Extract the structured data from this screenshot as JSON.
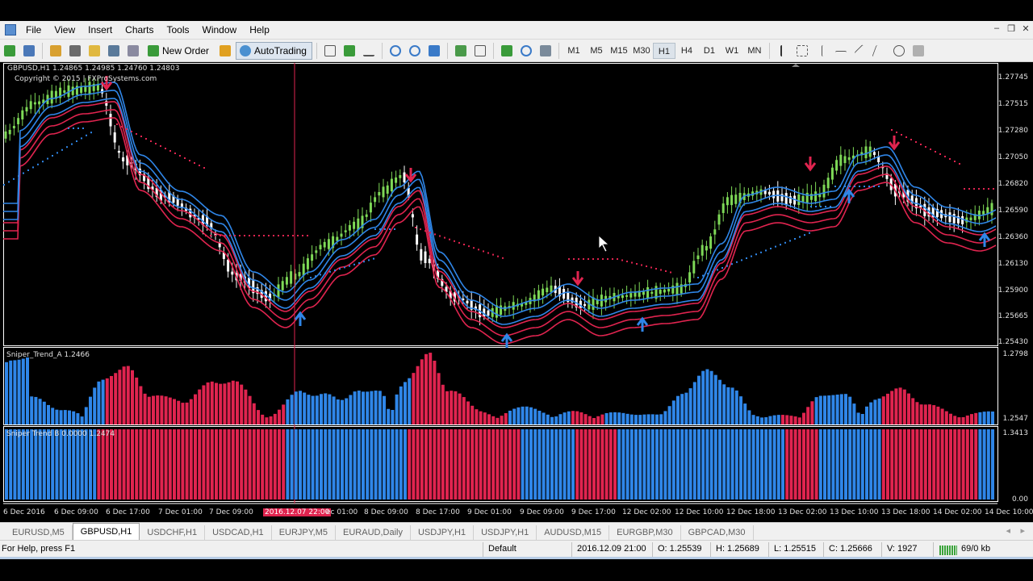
{
  "menu": [
    "File",
    "View",
    "Insert",
    "Charts",
    "Tools",
    "Window",
    "Help"
  ],
  "toolbar": {
    "new_order": "New Order",
    "autotrading": "AutoTrading",
    "timeframes": [
      "M1",
      "M5",
      "M15",
      "M30",
      "H1",
      "H4",
      "D1",
      "W1",
      "MN"
    ],
    "active_timeframe": "H1"
  },
  "chart": {
    "header": "GBPUSD,H1  1.24865 1.24985 1.24760 1.24803",
    "copyright": "Copyright © 2015 | FXProSystems.com",
    "price_labels": [
      "1.27745",
      "1.27515",
      "1.27280",
      "1.27050",
      "1.26820",
      "1.26590",
      "1.26360",
      "1.26130",
      "1.25900",
      "1.25665",
      "1.25430"
    ],
    "time_labels": [
      "6 Dec 2016",
      "6 Dec 09:00",
      "6 Dec 17:00",
      "7 Dec 01:00",
      "7 Dec 09:00",
      "2016.12.07 22:00",
      "ec 01:00",
      "8 Dec 09:00",
      "8 Dec 17:00",
      "9 Dec 01:00",
      "9 Dec 09:00",
      "9 Dec 17:00",
      "12 Dec 02:00",
      "12 Dec 10:00",
      "12 Dec 18:00",
      "13 Dec 02:00",
      "13 Dec 10:00",
      "13 Dec 18:00",
      "14 Dec 02:00",
      "14 Dec 10:00"
    ],
    "colors": {
      "bull": "#7ed957",
      "bear": "#ffffff",
      "red": "#e0244f",
      "blue": "#2f86e8"
    }
  },
  "indicator_a": {
    "label": "Sniper_Trend_A 1.2466",
    "max": "1.2798",
    "min": "1.2547"
  },
  "indicator_b": {
    "label": "Sniper Trend B 0.0000 1.2474",
    "max": "1.3413",
    "min": "0.00"
  },
  "tabs": [
    "EURUSD,M5",
    "GBPUSD,H1",
    "USDCHF,H1",
    "USDCAD,H1",
    "EURJPY,M5",
    "EURAUD,Daily",
    "USDJPY,H1",
    "USDJPY,H1",
    "AUDUSD,M15",
    "EURGBP,M30",
    "GBPCAD,M30"
  ],
  "active_tab": "GBPUSD,H1",
  "status": {
    "help": "For Help, press F1",
    "profile": "Default",
    "datetime": "2016.12.09 21:00",
    "open": "O: 1.25539",
    "high": "H: 1.25689",
    "low": "L: 1.25515",
    "close": "C: 1.25666",
    "volume": "V: 1927",
    "traffic": "69/0 kb"
  }
}
